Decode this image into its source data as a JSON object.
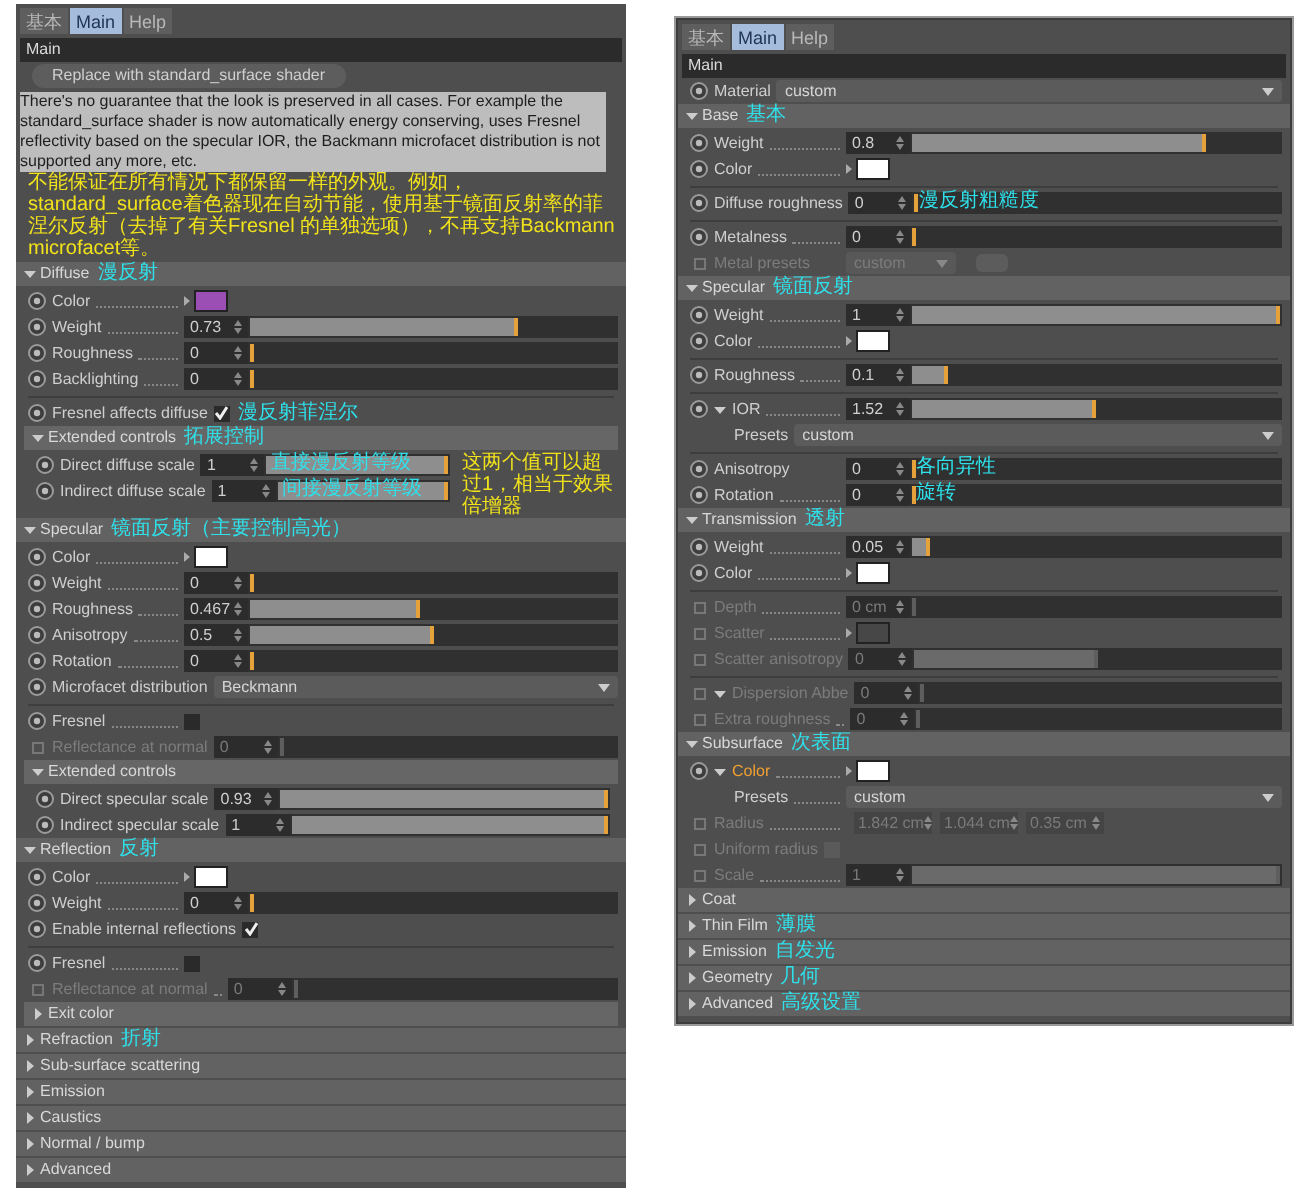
{
  "panels": [
    {
      "tabs": [
        {
          "label": "基本",
          "selected": false
        },
        {
          "label": "Main",
          "selected": true
        },
        {
          "label": "Help",
          "selected": false
        }
      ],
      "header": "Main",
      "items": [
        {
          "kind": "button",
          "label": "Replace with standard_surface shader"
        },
        {
          "kind": "text",
          "text": "There's no guarantee that the look is preserved in all cases. For example the standard_surface shader is now automatically energy conserving, uses Fresnel reflectivity based on the specular IOR, the Backmann microfacet distribution is not supported any more, etc.",
          "note": "不能保证在所有情况下都保留一样的外观。例如，standard_surface着色器现在自动节能，使用基于镜面反射率的菲涅尔反射（去掉了有关Fresnel 的单独选项），不再支持Backmann microfacet等。"
        },
        {
          "kind": "section",
          "label": "Diffuse",
          "note": "漫反射",
          "expanded": true,
          "items": [
            {
              "kind": "color",
              "label": "Color",
              "color": "#9b4fb5",
              "leader": true
            },
            {
              "kind": "slider",
              "label": "Weight",
              "value": "0.73",
              "level": 0.73,
              "leader": true
            },
            {
              "kind": "slider",
              "label": "Roughness",
              "value": "0",
              "level": 0,
              "leader": true
            },
            {
              "kind": "slider",
              "label": "Backlighting",
              "value": "0",
              "level": 0,
              "leader": true
            },
            {
              "kind": "divider"
            },
            {
              "kind": "check",
              "label": "Fresnel affects diffuse",
              "checked": true,
              "note": "漫反射菲涅尔"
            },
            {
              "kind": "section",
              "label": "Extended controls",
              "note": "拓展控制",
              "expanded": true,
              "annotation": "这两个值可以超过1，相当于效果倍增器",
              "items": [
                {
                  "kind": "slider",
                  "label": "Direct diffuse scale",
                  "value": "1",
                  "level": 1,
                  "note": "直接漫反射等级"
                },
                {
                  "kind": "slider",
                  "label": "Indirect diffuse scale",
                  "value": "1",
                  "level": 1,
                  "note": "间接漫反射等级"
                }
              ]
            }
          ]
        },
        {
          "kind": "section",
          "label": "Specular",
          "note": "镜面反射（主要控制高光）",
          "expanded": true,
          "items": [
            {
              "kind": "color",
              "label": "Color",
              "color": "#ffffff",
              "leader": true
            },
            {
              "kind": "slider",
              "label": "Weight",
              "value": "0",
              "level": 0,
              "leader": true
            },
            {
              "kind": "slider",
              "label": "Roughness",
              "value": "0.467",
              "level": 0.467,
              "leader": true
            },
            {
              "kind": "slider",
              "label": "Anisotropy",
              "value": "0.5",
              "level": 0.5,
              "leader": true
            },
            {
              "kind": "slider",
              "label": "Rotation",
              "value": "0",
              "level": 0,
              "leader": true
            },
            {
              "kind": "dropdown",
              "label": "Microfacet distribution",
              "value": "Beckmann"
            },
            {
              "kind": "divider"
            },
            {
              "kind": "check",
              "label": "Fresnel",
              "checked": false,
              "leader": true
            },
            {
              "kind": "slider",
              "label": "Reflectance at normal",
              "value": "0",
              "level": 0,
              "disabled": true
            },
            {
              "kind": "section",
              "label": "Extended controls",
              "expanded": true,
              "items": [
                {
                  "kind": "slider",
                  "label": "Direct specular scale",
                  "value": "0.93",
                  "level": 1
                },
                {
                  "kind": "slider",
                  "label": "Indirect specular scale",
                  "value": "1",
                  "level": 1
                }
              ]
            }
          ]
        },
        {
          "kind": "section",
          "label": "Reflection",
          "note": "反射",
          "expanded": true,
          "items": [
            {
              "kind": "color",
              "label": "Color",
              "color": "#ffffff",
              "leader": true
            },
            {
              "kind": "slider",
              "label": "Weight",
              "value": "0",
              "level": 0,
              "leader": true
            },
            {
              "kind": "check",
              "label": "Enable internal reflections",
              "checked": true
            },
            {
              "kind": "divider"
            },
            {
              "kind": "check",
              "label": "Fresnel",
              "checked": false,
              "leader": true
            },
            {
              "kind": "slider",
              "label": "Reflectance at normal",
              "value": "0",
              "level": 0,
              "disabled": true,
              "leader": true
            },
            {
              "kind": "section",
              "label": "Exit color",
              "expanded": false
            }
          ]
        },
        {
          "kind": "section",
          "label": "Refraction",
          "note": "折射",
          "expanded": false
        },
        {
          "kind": "section",
          "label": "Sub-surface scattering",
          "expanded": false
        },
        {
          "kind": "section",
          "label": "Emission",
          "expanded": false
        },
        {
          "kind": "section",
          "label": "Caustics",
          "expanded": false
        },
        {
          "kind": "section",
          "label": "Normal / bump",
          "expanded": false
        },
        {
          "kind": "section",
          "label": "Advanced",
          "expanded": false
        }
      ]
    },
    {
      "tabs": [
        {
          "label": "基本",
          "selected": false
        },
        {
          "label": "Main",
          "selected": true
        },
        {
          "label": "Help",
          "selected": false
        }
      ],
      "header": "Main",
      "items": [
        {
          "kind": "dropdown",
          "label": "Material",
          "value": "custom"
        },
        {
          "kind": "section",
          "label": "Base",
          "note": "基本",
          "expanded": true,
          "items": [
            {
              "kind": "slider",
              "label": "Weight",
              "value": "0.8",
              "level": 0.8,
              "leader": true
            },
            {
              "kind": "color",
              "label": "Color",
              "color": "#ffffff",
              "leader": true
            },
            {
              "kind": "divider"
            },
            {
              "kind": "slider",
              "label": "Diffuse roughness",
              "value": "0",
              "level": 0,
              "note": "漫反射粗糙度"
            },
            {
              "kind": "divider"
            },
            {
              "kind": "slider",
              "label": "Metalness",
              "value": "0",
              "level": 0,
              "leader": true
            },
            {
              "kind": "preset",
              "label": "Metal presets",
              "value": "custom",
              "disabled": true
            }
          ]
        },
        {
          "kind": "section",
          "label": "Specular",
          "note": "镜面反射",
          "expanded": true,
          "items": [
            {
              "kind": "slider",
              "label": "Weight",
              "value": "1",
              "level": 1,
              "leader": true
            },
            {
              "kind": "color",
              "label": "Color",
              "color": "#ffffff",
              "leader": true
            },
            {
              "kind": "divider"
            },
            {
              "kind": "slider",
              "label": "Roughness",
              "value": "0.1",
              "level": 0.1,
              "leader": true
            },
            {
              "kind": "divider"
            },
            {
              "kind": "slider",
              "label": "IOR",
              "value": "1.52",
              "level": 0.5,
              "expander": true,
              "leader": true
            },
            {
              "kind": "dropdown",
              "label": "Presets",
              "value": "custom",
              "unkeyed": true
            },
            {
              "kind": "divider"
            },
            {
              "kind": "slider",
              "label": "Anisotropy",
              "value": "0",
              "level": 0,
              "note": "各向异性"
            },
            {
              "kind": "slider",
              "label": "Rotation",
              "value": "0",
              "level": 0,
              "note": "旋转",
              "leader": true
            }
          ]
        },
        {
          "kind": "section",
          "label": "Transmission",
          "note": "透射",
          "expanded": true,
          "items": [
            {
              "kind": "slider",
              "label": "Weight",
              "value": "0.05",
              "level": 0.05,
              "leader": true
            },
            {
              "kind": "color",
              "label": "Color",
              "color": "#ffffff",
              "leader": true
            },
            {
              "kind": "divider"
            },
            {
              "kind": "slider",
              "label": "Depth",
              "value": "0 cm",
              "level": 0,
              "disabled": true,
              "leader": true
            },
            {
              "kind": "color",
              "label": "Scatter",
              "color": "#474747",
              "disabled": true,
              "leader": true
            },
            {
              "kind": "slider",
              "label": "Scatter anisotropy",
              "value": "0",
              "level": 0.5,
              "disabled": true
            },
            {
              "kind": "divider"
            },
            {
              "kind": "slider",
              "label": "Dispersion Abbe",
              "value": "0",
              "level": 0,
              "disabled": true,
              "expander": true
            },
            {
              "kind": "slider",
              "label": "Extra roughness",
              "value": "0",
              "level": 0,
              "disabled": true,
              "leader": true
            }
          ]
        },
        {
          "kind": "section",
          "label": "Subsurface",
          "note": "次表面",
          "expanded": true,
          "items": [
            {
              "kind": "color",
              "label": "Color",
              "color": "#ffffff",
              "accent": true,
              "expander": true,
              "leader": true
            },
            {
              "kind": "dropdown",
              "label": "Presets",
              "value": "custom",
              "unkeyed": true,
              "leader": true
            },
            {
              "kind": "triple",
              "label": "Radius",
              "values": [
                "1.842 cm",
                "1.044 cm",
                "0.35 cm"
              ],
              "disabled": true,
              "leader": true
            },
            {
              "kind": "check",
              "label": "Uniform radius",
              "checked": false,
              "disabled": true
            },
            {
              "kind": "slider",
              "label": "Scale",
              "value": "1",
              "level": 1,
              "disabled": true,
              "leader": true
            }
          ]
        },
        {
          "kind": "section",
          "label": "Coat",
          "expanded": false
        },
        {
          "kind": "section",
          "label": "Thin Film",
          "note": "薄膜",
          "expanded": false
        },
        {
          "kind": "section",
          "label": "Emission",
          "note": "自发光",
          "expanded": false
        },
        {
          "kind": "section",
          "label": "Geometry",
          "note": "几何",
          "expanded": false
        },
        {
          "kind": "section",
          "label": "Advanced",
          "note": "高级设置",
          "expanded": false
        }
      ]
    }
  ]
}
